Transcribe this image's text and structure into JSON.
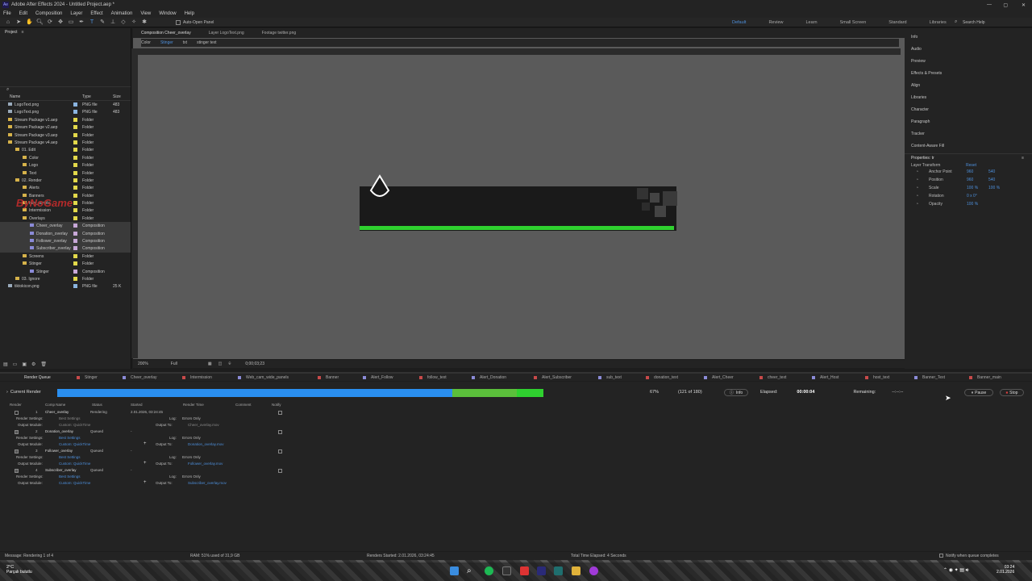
{
  "window": {
    "title": "Adobe After Effects 2024 - Untitled Project.aep *"
  },
  "menu": [
    "File",
    "Edit",
    "Composition",
    "Layer",
    "Effect",
    "Animation",
    "View",
    "Window",
    "Help"
  ],
  "toolbar": {
    "auto_open_panel": "Auto-Open Panel"
  },
  "workspaces": [
    "Default",
    "Review",
    "Learn",
    "Small Screen",
    "Standard",
    "Libraries"
  ],
  "search_help": "Search Help",
  "project": {
    "title": "Project",
    "columns": {
      "name": "Name",
      "type": "Type",
      "size": "Size"
    },
    "items": [
      {
        "name": "LogoText.png",
        "type": "PNG file",
        "size": "483",
        "indent": 0,
        "color": "#8ab4e0"
      },
      {
        "name": "LogoText.png",
        "type": "PNG file",
        "size": "483",
        "indent": 0,
        "color": "#8ab4e0"
      },
      {
        "name": "Stream Package v1.aep",
        "type": "Folder",
        "size": "",
        "indent": 0,
        "color": "#e2d84a"
      },
      {
        "name": "Stream Package v2.aep",
        "type": "Folder",
        "size": "",
        "indent": 0,
        "color": "#e2d84a"
      },
      {
        "name": "Stream Package v3.aep",
        "type": "Folder",
        "size": "",
        "indent": 0,
        "color": "#e2d84a"
      },
      {
        "name": "Stream Package v4.aep",
        "type": "Folder",
        "size": "",
        "indent": 0,
        "color": "#e2d84a"
      },
      {
        "name": "01. Edit",
        "type": "Folder",
        "size": "",
        "indent": 1,
        "color": "#e2d84a"
      },
      {
        "name": "Color",
        "type": "Folder",
        "size": "",
        "indent": 2,
        "color": "#e2d84a"
      },
      {
        "name": "Logo",
        "type": "Folder",
        "size": "",
        "indent": 2,
        "color": "#e2d84a"
      },
      {
        "name": "Text",
        "type": "Folder",
        "size": "",
        "indent": 2,
        "color": "#e2d84a"
      },
      {
        "name": "02. Render",
        "type": "Folder",
        "size": "",
        "indent": 1,
        "color": "#e2d84a"
      },
      {
        "name": "Alerts",
        "type": "Folder",
        "size": "",
        "indent": 2,
        "color": "#e2d84a"
      },
      {
        "name": "Banners",
        "type": "Folder",
        "size": "",
        "indent": 2,
        "color": "#e2d84a"
      },
      {
        "name": "Info_panels",
        "type": "Folder",
        "size": "",
        "indent": 2,
        "color": "#e2d84a"
      },
      {
        "name": "Intermission",
        "type": "Folder",
        "size": "",
        "indent": 2,
        "color": "#e2d84a"
      },
      {
        "name": "Overlays",
        "type": "Folder",
        "size": "",
        "indent": 2,
        "color": "#e2d84a"
      },
      {
        "name": "Cheer_overlay",
        "type": "Composition",
        "size": "",
        "indent": 3,
        "color": "#c8a8d8",
        "sel": true
      },
      {
        "name": "Donation_overlay",
        "type": "Composition",
        "size": "",
        "indent": 3,
        "color": "#c8a8d8",
        "sel": true
      },
      {
        "name": "Follower_overlay",
        "type": "Composition",
        "size": "",
        "indent": 3,
        "color": "#c8a8d8",
        "sel": true
      },
      {
        "name": "Subscriber_overlay",
        "type": "Composition",
        "size": "",
        "indent": 3,
        "color": "#c8a8d8",
        "sel": true
      },
      {
        "name": "Screens",
        "type": "Folder",
        "size": "",
        "indent": 2,
        "color": "#e2d84a"
      },
      {
        "name": "Stinger",
        "type": "Folder",
        "size": "",
        "indent": 2,
        "color": "#e2d84a"
      },
      {
        "name": "Stinger",
        "type": "Composition",
        "size": "",
        "indent": 3,
        "color": "#c8a8d8"
      },
      {
        "name": "03. Ignore",
        "type": "Folder",
        "size": "",
        "indent": 1,
        "color": "#e2d84a"
      },
      {
        "name": "tiktokicon.png",
        "type": "PNG file",
        "size": "25 K",
        "indent": 0,
        "color": "#8ab4e0"
      }
    ]
  },
  "watermark": "ByNoGame",
  "comp_tabs": [
    "Composition Cheer_overlay",
    "Layer LogoText.png",
    "Footage twitter.png"
  ],
  "comp_subtabs": [
    "Color",
    "Stinger",
    "txt",
    "stinger text"
  ],
  "viewer": {
    "zoom": "200%",
    "resolution": "Full",
    "timecode": "0;00;03;23"
  },
  "right_panel": {
    "items": [
      "Info",
      "Audio",
      "Preview",
      "Effects & Presets",
      "Align",
      "Libraries",
      "Character",
      "Paragraph",
      "Tracker",
      "Content-Aware Fill"
    ],
    "properties_title": "Properties: tr",
    "layer_transform": "Layer Transform",
    "reset": "Reset",
    "props": [
      {
        "label": "Anchor Point",
        "v1": "960",
        "v2": "540"
      },
      {
        "label": "Position",
        "v1": "960",
        "v2": "540"
      },
      {
        "label": "Scale",
        "v1": "100 %",
        "v2": "100 %"
      },
      {
        "label": "Rotation",
        "v1": "0 x 0°",
        "v2": ""
      },
      {
        "label": "Opacity",
        "v1": "100 %",
        "v2": ""
      }
    ]
  },
  "rq_tabs": [
    "Render Queue",
    "Stinger",
    "Cheer_overlay",
    "Intermission",
    "Web_cam_wide_panels",
    "Banner",
    "Alert_Follow",
    "follow_text",
    "Alert_Donation",
    "Alert_Subscriber",
    "sub_text",
    "donation_text",
    "Alert_Cheer",
    "cheer_text",
    "Alert_Host",
    "host_text",
    "Banner_Text",
    "Banner_main"
  ],
  "render": {
    "current_render": "Current Render",
    "percent": "67%",
    "frames": "(121 of 180)",
    "progress": 0.67,
    "info": "Info",
    "elapsed_label": "Elapsed:",
    "elapsed": "00:00:04",
    "remaining_label": "Remaining:",
    "remaining": "--:--:--",
    "pause": "Pause",
    "stop": "Stop",
    "columns": [
      "Render",
      "Comp Name",
      "Status",
      "Started",
      "Render Time",
      "Comment",
      "Notify"
    ],
    "items": [
      {
        "num": "1",
        "name": "Cheer_overlay",
        "status": "Rendering",
        "started": "2.01.2026, 03:24:45",
        "output": "Cheer_overlay.mov"
      },
      {
        "num": "2",
        "name": "Donation_overlay",
        "status": "Queued",
        "started": "-",
        "output": "Donation_overlay.mov"
      },
      {
        "num": "3",
        "name": "Follower_overlay",
        "status": "Queued",
        "started": "-",
        "output": "Follower_overlay.mov"
      },
      {
        "num": "4",
        "name": "Subscriber_overlay",
        "status": "Queued",
        "started": "-",
        "output": "Subscriber_overlay.mov"
      }
    ],
    "render_settings_label": "Render Settings:",
    "render_settings": "Best Settings",
    "output_module_label": "Output Module:",
    "output_module": "Custom: QuickTime",
    "log_label": "Log:",
    "log": "Errors Only",
    "output_to_label": "Output To:"
  },
  "statusbar": {
    "message": "Message: Rendering 1 of 4",
    "ram": "RAM: 51% used of 31,9 GB",
    "renders_started": "Renders Started: 2.01.2026, 03:24:45",
    "total_elapsed": "Total Time Elapsed: 4 Seconds",
    "notify": "Notify when queue completes"
  },
  "taskbar": {
    "weather_temp": "2°C",
    "weather_text": "Parçalı bulutlu",
    "time": "03:24",
    "date": "2.01.2026"
  }
}
